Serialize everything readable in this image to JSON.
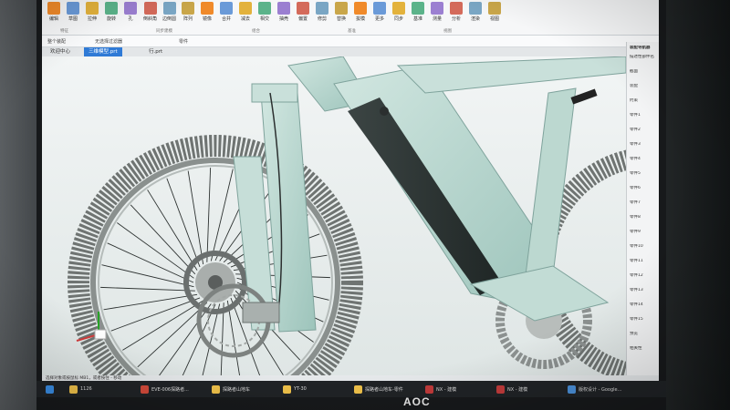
{
  "app": {
    "ribbon_buttons": [
      "编辑",
      "草图",
      "拉伸",
      "旋转",
      "孔",
      "倒斜角",
      "边倒圆",
      "阵列",
      "镜像",
      "合并",
      "减去",
      "相交",
      "抽壳",
      "偏置",
      "修剪",
      "替换",
      "拔模",
      "更多",
      "同步",
      "基准",
      "测量",
      "分析",
      "渲染",
      "视图"
    ],
    "ribbon_groups": [
      "特征",
      "同步建模",
      "组合",
      "基准",
      "视图"
    ],
    "quick_filter": "整个装配",
    "quick_scope": "无选择过滤器",
    "quick_selection": "零件",
    "tabs": [
      {
        "label": "欢迎中心",
        "active": false
      },
      {
        "label": "三维模型.prt",
        "active": true
      },
      {
        "label": "行.prt",
        "active": false
      }
    ],
    "status_text": "选择对象或按鼠标 MB1，或者按住 - 移动"
  },
  "sidepanel": {
    "title": "装配导航器",
    "rows": [
      "描述性部件名",
      "截面",
      "装配",
      "约束",
      "零件1",
      "零件2",
      "零件3",
      "零件4",
      "零件5",
      "零件6",
      "零件7",
      "零件8",
      "零件9",
      "零件10",
      "零件11",
      "零件12",
      "零件13",
      "零件14",
      "零件15",
      "预览",
      "相关性"
    ]
  },
  "taskbar": {
    "items": [
      {
        "label": "1126",
        "color": "#f0c24a"
      },
      {
        "label": "EVE-006探路者...",
        "color": "#d24a3a"
      },
      {
        "label": "探路者山地车",
        "color": "#f0c24a"
      },
      {
        "label": "YT-30",
        "color": "#f0c24a"
      },
      {
        "label": "探路者山地车-零件",
        "color": "#f0c24a"
      },
      {
        "label": "NX - 建模",
        "color": "#c23b3b"
      },
      {
        "label": "NX - 建模",
        "color": "#c23b3b"
      },
      {
        "label": "版权设计 - Google...",
        "color": "#4a90d9"
      }
    ]
  },
  "monitor": {
    "brand": "AOC"
  },
  "colors": {
    "frame": "#b9d8d0",
    "frame_dark": "#7fa39c",
    "tire": "#6f7472",
    "accent_blue": "#2f7ad6"
  }
}
